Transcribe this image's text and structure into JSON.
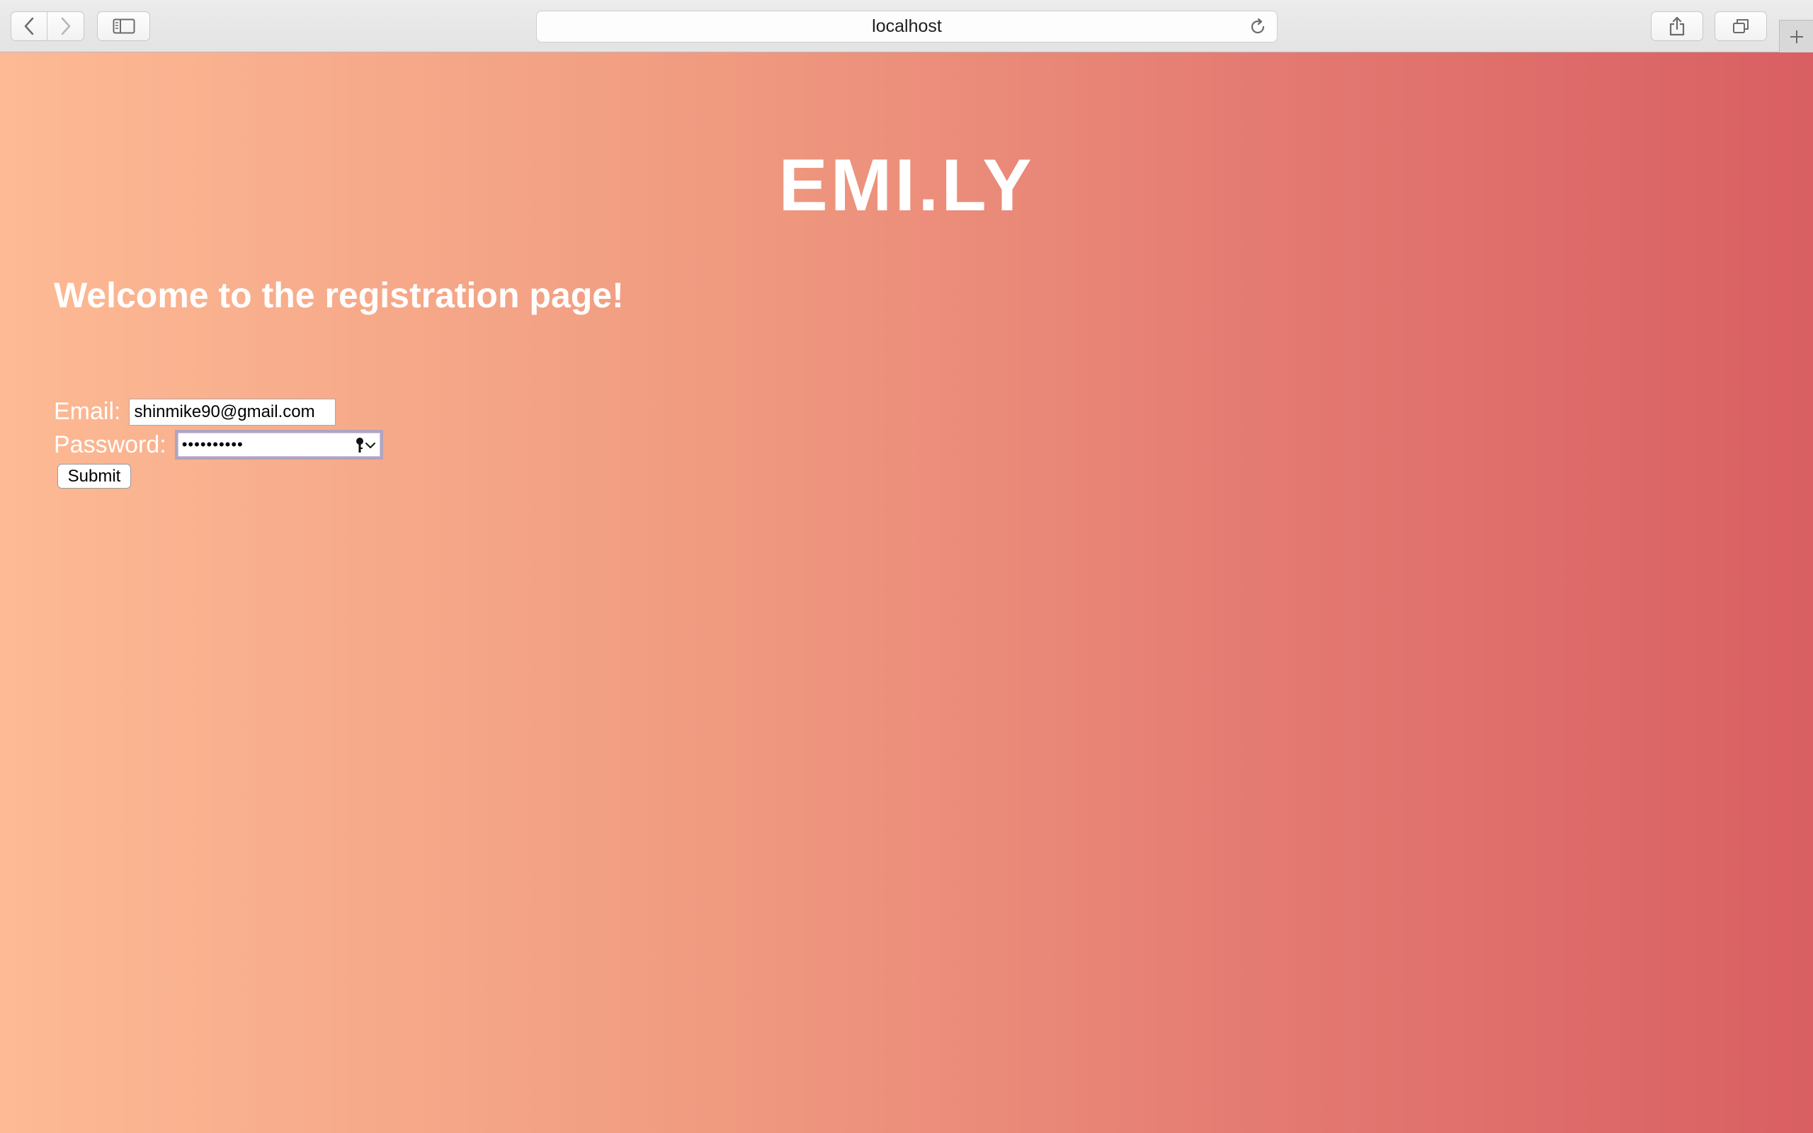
{
  "browser": {
    "url": "localhost"
  },
  "page": {
    "logo": "EMI.LY",
    "heading": "Welcome to the registration page!",
    "form": {
      "email_label": "Email:",
      "email_value": "shinmike90@gmail.com",
      "password_label": "Password:",
      "password_value": "••••••••••",
      "submit_label": "Submit"
    }
  },
  "colors": {
    "gradient_start": "#fdba94",
    "gradient_end": "#d95f62",
    "text": "#ffffff"
  }
}
